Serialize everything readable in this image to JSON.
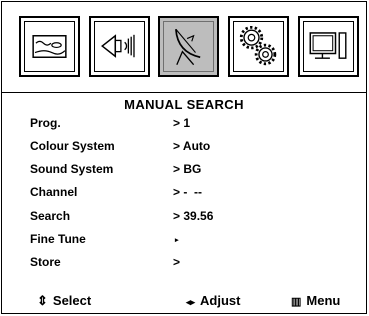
{
  "menu_icons": [
    {
      "icon": "picture-icon",
      "selected": false
    },
    {
      "icon": "speaker-icon",
      "selected": false
    },
    {
      "icon": "satellite-dish-icon",
      "selected": true
    },
    {
      "icon": "gears-icon",
      "selected": false
    },
    {
      "icon": "monitor-icon",
      "selected": false
    }
  ],
  "title": "MANUAL SEARCH",
  "rows": [
    {
      "label": "Prog.",
      "value": "> 1"
    },
    {
      "label": "Colour System",
      "value": "> Auto"
    },
    {
      "label": "Sound System",
      "value": "> BG"
    },
    {
      "label": "Channel",
      "value": "> -  --"
    },
    {
      "label": "Search",
      "value": "> 39.56"
    },
    {
      "label": "Fine Tune",
      "value": "▸"
    },
    {
      "label": "Store",
      "value": ">"
    }
  ],
  "footer": {
    "select_symbol": "⇕",
    "select_label": "Select",
    "adjust_symbol": "◂▸",
    "adjust_label": "Adjust",
    "menu_symbol": "▥",
    "menu_label": "Menu"
  }
}
